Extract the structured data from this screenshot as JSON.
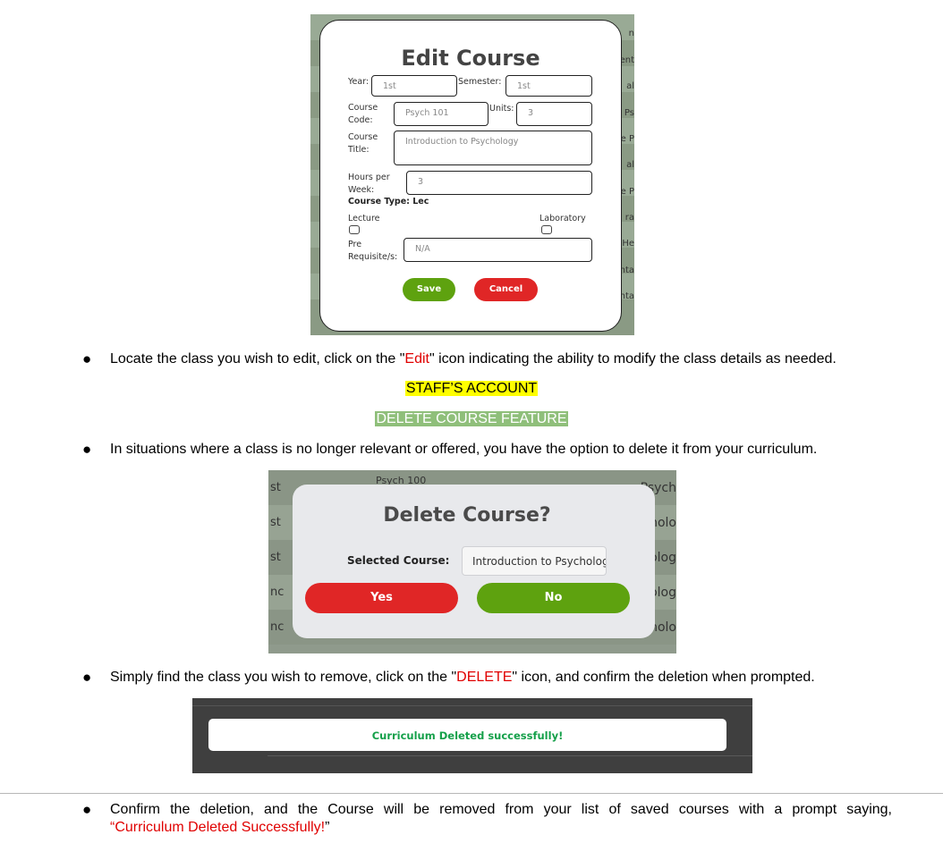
{
  "edit_screenshot": {
    "title": "Edit Course",
    "year_label": "Year:",
    "year_value": "1st",
    "semester_label": "Semester:",
    "semester_value": "1st",
    "course_code_label_1": "Course",
    "course_code_label_2": "Code:",
    "course_code_value": "Psych 101",
    "units_label": "Units:",
    "units_value": "3",
    "course_title_label_1": "Course",
    "course_title_label_2": "Title:",
    "course_title_value": "Introduction to Psychology",
    "hours_label_1": "Hours per",
    "hours_label_2": "Week:",
    "hours_value": "3",
    "course_type": "Course Type: Lec",
    "lecture_label": "Lecture",
    "laboratory_label": "Laboratory",
    "prereq_label_1": "Pre",
    "prereq_label_2": "Requisite/s:",
    "prereq_value": "N/A",
    "save_label": "Save",
    "cancel_label": "Cancel",
    "bg_fragments": [
      "n",
      "ent",
      "al",
      "Ps",
      "e P",
      "al",
      "e P",
      "ra",
      "He",
      "nta",
      "nta"
    ]
  },
  "instructions": {
    "edit_before": "Locate the class you wish to edit, click on the \"",
    "edit_word": "Edit",
    "edit_after": "\" icon indicating the ability to modify the class details as needed.",
    "staff_heading": "STAFF’S ACCOUNT",
    "delete_heading": "DELETE COURSE FEATURE",
    "delete_intro": "In situations where a class is no longer relevant or offered, you have the option to delete it from your curriculum.",
    "delete_before": "Simply find the class you wish to remove, click on the \"",
    "delete_word": "DELETE",
    "delete_after": "\" icon, and confirm the deletion when prompted.",
    "confirm_line1": "Confirm the deletion, and the Course will be removed from your list of saved courses with a prompt saying,",
    "confirm_open_quote": "“",
    "confirm_red": "Curriculum Deleted Successfully!",
    "confirm_close_quote": "”"
  },
  "delete_screenshot": {
    "title": "Delete Course?",
    "selected_label": "Selected Course:",
    "selected_value": "Introduction to Psycholog",
    "yes_label": "Yes",
    "no_label": "No",
    "bg_left": [
      "st",
      "st",
      "st",
      "nc",
      "nc"
    ],
    "bg_right": [
      "Psych",
      "holo",
      "olog",
      "olog",
      "holo"
    ],
    "bg_top_mid": "Psych 100"
  },
  "toast_screenshot": {
    "message": "Curriculum Deleted successfully!"
  },
  "colors": {
    "save_green": "#5ea20f",
    "cancel_red": "#e02626",
    "yes_red": "#e02626",
    "no_green": "#5ea20f",
    "toast_text_green": "#15a04a",
    "highlight_yellow": "#ffff00",
    "highlight_green": "#8fbf7a",
    "instruction_red": "#e00000"
  }
}
